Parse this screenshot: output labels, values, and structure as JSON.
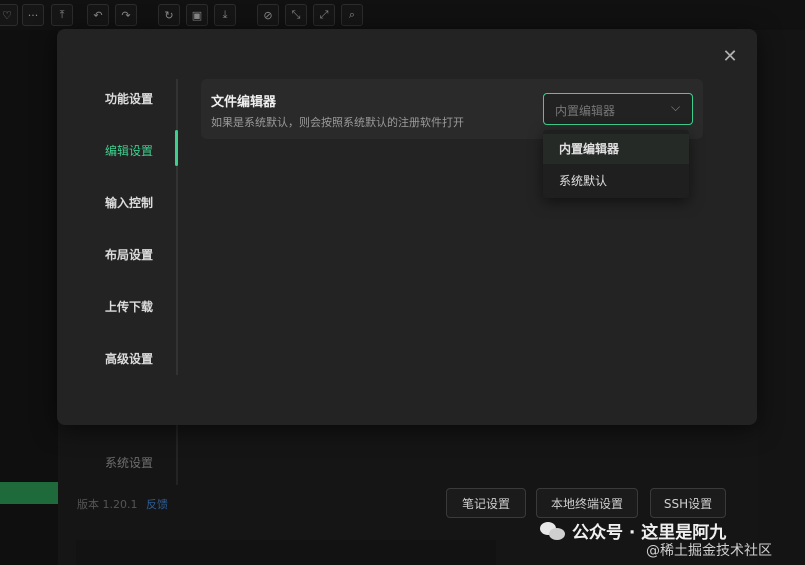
{
  "toolbar": {
    "icons": [
      "heart-icon",
      "more-icon",
      "upload-icon",
      "undo-icon",
      "redo-icon",
      "refresh-icon",
      "save-icon",
      "download-icon",
      "compass-icon",
      "collapse-icon",
      "expand-icon",
      "search-icon"
    ]
  },
  "background": {
    "system_settings": "系统设置",
    "version": "版本 1.20.1",
    "feedback": "反馈",
    "buttons": [
      "笔记设置",
      "本地终端设置",
      "SSH设置"
    ]
  },
  "modal": {
    "nav": [
      {
        "label": "功能设置"
      },
      {
        "label": "编辑设置",
        "active": true
      },
      {
        "label": "输入控制"
      },
      {
        "label": "布局设置"
      },
      {
        "label": "上传下载"
      },
      {
        "label": "高级设置"
      }
    ],
    "setting": {
      "title": "文件编辑器",
      "description": "如果是系统默认，则会按照系统默认的注册软件打开",
      "select_value": "内置编辑器",
      "options": [
        "内置编辑器",
        "系统默认"
      ]
    }
  },
  "watermark": {
    "line1": "公众号 · 这里是阿九",
    "line2": "@稀土掘金技术社区"
  },
  "colors": {
    "accent": "#3ecf8e",
    "modal_bg": "#232323",
    "page_bg": "#141414"
  }
}
